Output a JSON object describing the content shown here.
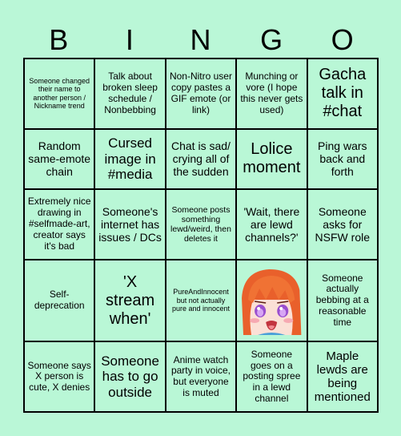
{
  "header": {
    "letters": [
      "B",
      "I",
      "N",
      "G",
      "O"
    ]
  },
  "board": {
    "rows": [
      [
        {
          "text": "Someone changed their name to another person / Nickname trend"
        },
        {
          "text": "Talk about broken sleep schedule / Nonbebbing"
        },
        {
          "text": "Non-Nitro user copy pastes a GIF emote (or link)"
        },
        {
          "text": "Munching or vore (I hope this never gets used)"
        },
        {
          "text": "Gacha talk in #chat"
        }
      ],
      [
        {
          "text": "Random same-emote chain"
        },
        {
          "text": "Cursed image in #media"
        },
        {
          "text": "Chat is sad/ crying all of the sudden"
        },
        {
          "text": "Lolice moment"
        },
        {
          "text": "Ping wars back and forth"
        }
      ],
      [
        {
          "text": "Extremely nice drawing in #selfmade-art, creator says it's bad"
        },
        {
          "text": "Someone's internet has issues / DCs"
        },
        {
          "text": "Someone posts something lewd/weird, then deletes it"
        },
        {
          "text": "'Wait, there are lewd channels?'"
        },
        {
          "text": "Someone asks for NSFW role"
        }
      ],
      [
        {
          "text": "Self-deprecation"
        },
        {
          "text": "'X stream when'"
        },
        {
          "text": "PureAndInnocent but not actually pure and innocent"
        },
        {
          "text": "",
          "image": "anime-girl-free-space"
        },
        {
          "text": "Someone actually bebbing at a reasonable time"
        }
      ],
      [
        {
          "text": "Someone says X person is cute, X denies"
        },
        {
          "text": "Someone has to go outside"
        },
        {
          "text": "Anime watch party in voice, but everyone is muted"
        },
        {
          "text": "Someone goes on a posting spree in a lewd channel"
        },
        {
          "text": "Maple lewds are being mentioned"
        }
      ]
    ]
  },
  "colors": {
    "background": "#baf7d7",
    "cell": "#b9f7d6",
    "border": "#000000"
  }
}
